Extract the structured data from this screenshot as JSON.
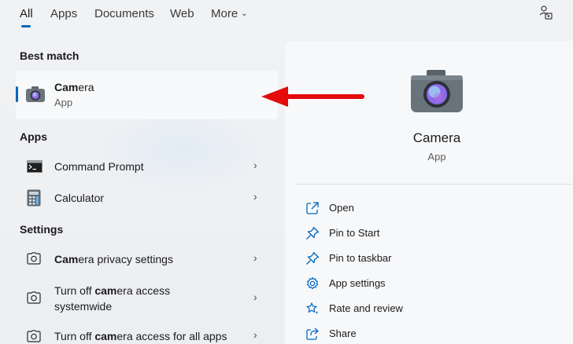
{
  "tabs": [
    {
      "label": "All"
    },
    {
      "label": "Apps"
    },
    {
      "label": "Documents"
    },
    {
      "label": "Web"
    },
    {
      "label": "More"
    }
  ],
  "sections": {
    "best_match": "Best match",
    "apps": "Apps",
    "settings": "Settings"
  },
  "best_match": {
    "title_bold": "Cam",
    "title_rest": "era",
    "subtitle": "App",
    "icon": "camera-app-icon"
  },
  "apps": [
    {
      "label": "Command Prompt",
      "icon": "command-prompt-icon"
    },
    {
      "label": "Calculator",
      "icon": "calculator-icon"
    }
  ],
  "settings": [
    {
      "bold": "Cam",
      "rest": "era privacy settings",
      "icon": "camera-settings-icon"
    },
    {
      "line1_pre": "Turn off ",
      "line1_bold": "cam",
      "line1_post": "era access",
      "line2": "systemwide",
      "icon": "camera-settings-icon"
    },
    {
      "pre": "Turn off ",
      "bold": "cam",
      "post": "era access for all apps",
      "icon": "camera-settings-icon"
    }
  ],
  "detail": {
    "title": "Camera",
    "subtitle": "App",
    "actions": [
      {
        "label": "Open",
        "icon": "open-external-icon"
      },
      {
        "label": "Pin to Start",
        "icon": "pin-icon"
      },
      {
        "label": "Pin to taskbar",
        "icon": "pin-icon"
      },
      {
        "label": "App settings",
        "icon": "gear-icon"
      },
      {
        "label": "Rate and review",
        "icon": "star-sparkle-icon"
      },
      {
        "label": "Share",
        "icon": "share-icon"
      }
    ]
  },
  "colors": {
    "accent": "#0067c0",
    "annotation_arrow": "#e30b0b"
  }
}
